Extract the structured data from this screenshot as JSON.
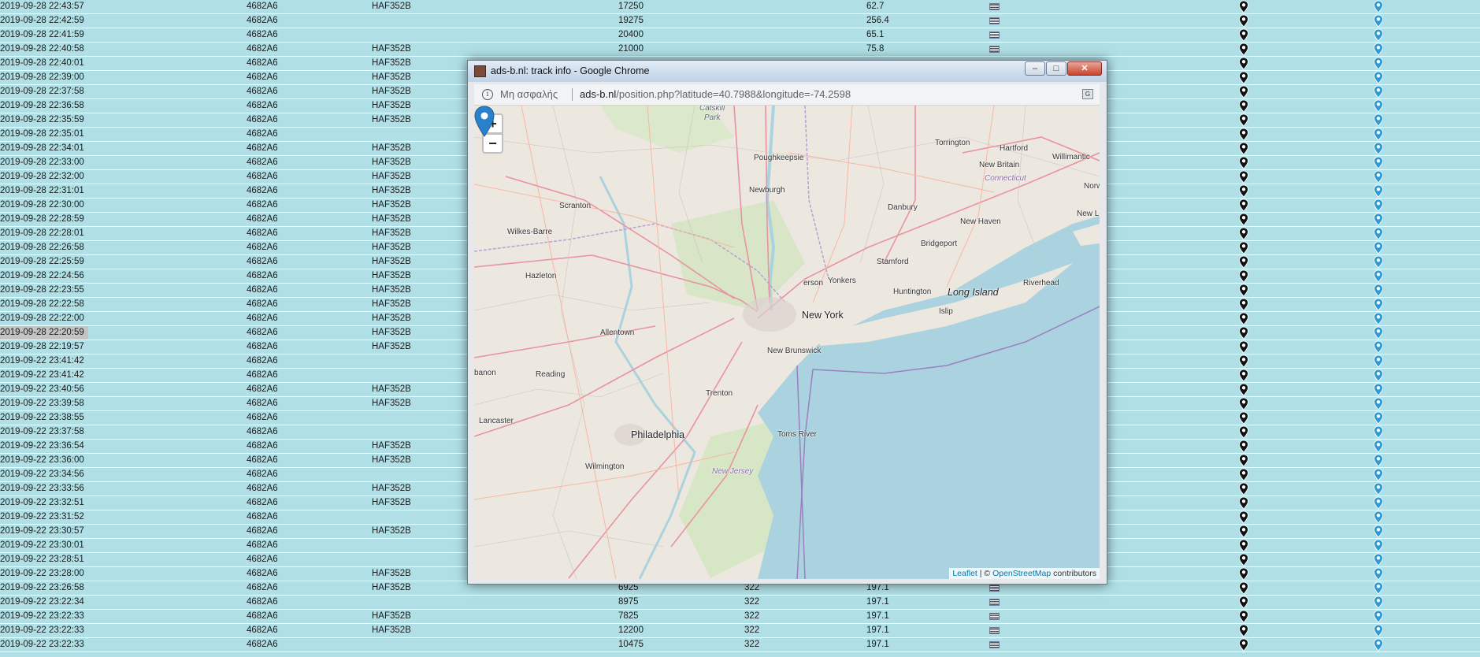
{
  "rows": [
    {
      "time": "2019-09-28 22:43:57",
      "icao": "4682A6",
      "reg": "HAF352B",
      "alt": "17250",
      "speed": "62.7"
    },
    {
      "time": "2019-09-28 22:42:59",
      "icao": "4682A6",
      "reg": "",
      "alt": "19275",
      "speed": "256.4"
    },
    {
      "time": "2019-09-28 22:41:59",
      "icao": "4682A6",
      "reg": "",
      "alt": "20400",
      "speed": "65.1"
    },
    {
      "time": "2019-09-28 22:40:58",
      "icao": "4682A6",
      "reg": "HAF352B",
      "alt": "21000",
      "speed": "75.8"
    },
    {
      "time": "2019-09-28 22:40:01",
      "icao": "4682A6",
      "reg": "HAF352B",
      "alt": "",
      "speed": ""
    },
    {
      "time": "2019-09-28 22:39:00",
      "icao": "4682A6",
      "reg": "HAF352B",
      "alt": "",
      "speed": ""
    },
    {
      "time": "2019-09-28 22:37:58",
      "icao": "4682A6",
      "reg": "HAF352B",
      "alt": "",
      "speed": ""
    },
    {
      "time": "2019-09-28 22:36:58",
      "icao": "4682A6",
      "reg": "HAF352B",
      "alt": "",
      "speed": ""
    },
    {
      "time": "2019-09-28 22:35:59",
      "icao": "4682A6",
      "reg": "HAF352B",
      "alt": "",
      "speed": ""
    },
    {
      "time": "2019-09-28 22:35:01",
      "icao": "4682A6",
      "reg": "",
      "alt": "",
      "speed": ""
    },
    {
      "time": "2019-09-28 22:34:01",
      "icao": "4682A6",
      "reg": "HAF352B",
      "alt": "",
      "speed": ""
    },
    {
      "time": "2019-09-28 22:33:00",
      "icao": "4682A6",
      "reg": "HAF352B",
      "alt": "",
      "speed": ""
    },
    {
      "time": "2019-09-28 22:32:00",
      "icao": "4682A6",
      "reg": "HAF352B",
      "alt": "",
      "speed": ""
    },
    {
      "time": "2019-09-28 22:31:01",
      "icao": "4682A6",
      "reg": "HAF352B",
      "alt": "",
      "speed": ""
    },
    {
      "time": "2019-09-28 22:30:00",
      "icao": "4682A6",
      "reg": "HAF352B",
      "alt": "",
      "speed": ""
    },
    {
      "time": "2019-09-28 22:28:59",
      "icao": "4682A6",
      "reg": "HAF352B",
      "alt": "",
      "speed": ""
    },
    {
      "time": "2019-09-28 22:28:01",
      "icao": "4682A6",
      "reg": "HAF352B",
      "alt": "",
      "speed": ""
    },
    {
      "time": "2019-09-28 22:26:58",
      "icao": "4682A6",
      "reg": "HAF352B",
      "alt": "",
      "speed": ""
    },
    {
      "time": "2019-09-28 22:25:59",
      "icao": "4682A6",
      "reg": "HAF352B",
      "alt": "",
      "speed": ""
    },
    {
      "time": "2019-09-28 22:24:56",
      "icao": "4682A6",
      "reg": "HAF352B",
      "alt": "",
      "speed": ""
    },
    {
      "time": "2019-09-28 22:23:55",
      "icao": "4682A6",
      "reg": "HAF352B",
      "alt": "",
      "speed": ""
    },
    {
      "time": "2019-09-28 22:22:58",
      "icao": "4682A6",
      "reg": "HAF352B",
      "alt": "",
      "speed": ""
    },
    {
      "time": "2019-09-28 22:22:00",
      "icao": "4682A6",
      "reg": "HAF352B",
      "alt": "",
      "speed": ""
    },
    {
      "time": "2019-09-28 22:20:59",
      "icao": "4682A6",
      "reg": "HAF352B",
      "alt": "",
      "speed": "",
      "highlight": true
    },
    {
      "time": "2019-09-28 22:19:57",
      "icao": "4682A6",
      "reg": "HAF352B",
      "alt": "",
      "speed": ""
    },
    {
      "time": "2019-09-22 23:41:42",
      "icao": "4682A6",
      "reg": "",
      "alt": "",
      "speed": ""
    },
    {
      "time": "2019-09-22 23:41:42",
      "icao": "4682A6",
      "reg": "",
      "alt": "",
      "speed": ""
    },
    {
      "time": "2019-09-22 23:40:56",
      "icao": "4682A6",
      "reg": "HAF352B",
      "alt": "",
      "speed": ""
    },
    {
      "time": "2019-09-22 23:39:58",
      "icao": "4682A6",
      "reg": "HAF352B",
      "alt": "",
      "speed": ""
    },
    {
      "time": "2019-09-22 23:38:55",
      "icao": "4682A6",
      "reg": "",
      "alt": "",
      "speed": ""
    },
    {
      "time": "2019-09-22 23:37:58",
      "icao": "4682A6",
      "reg": "",
      "alt": "",
      "speed": ""
    },
    {
      "time": "2019-09-22 23:36:54",
      "icao": "4682A6",
      "reg": "HAF352B",
      "alt": "",
      "speed": ""
    },
    {
      "time": "2019-09-22 23:36:00",
      "icao": "4682A6",
      "reg": "HAF352B",
      "alt": "",
      "speed": ""
    },
    {
      "time": "2019-09-22 23:34:56",
      "icao": "4682A6",
      "reg": "",
      "alt": "",
      "speed": ""
    },
    {
      "time": "2019-09-22 23:33:56",
      "icao": "4682A6",
      "reg": "HAF352B",
      "alt": "",
      "speed": ""
    },
    {
      "time": "2019-09-22 23:32:51",
      "icao": "4682A6",
      "reg": "HAF352B",
      "alt": "",
      "speed": ""
    },
    {
      "time": "2019-09-22 23:31:52",
      "icao": "4682A6",
      "reg": "",
      "alt": "",
      "speed": ""
    },
    {
      "time": "2019-09-22 23:30:57",
      "icao": "4682A6",
      "reg": "HAF352B",
      "alt": "",
      "speed": ""
    },
    {
      "time": "2019-09-22 23:30:01",
      "icao": "4682A6",
      "reg": "",
      "alt": "",
      "speed": ""
    },
    {
      "time": "2019-09-22 23:28:51",
      "icao": "4682A6",
      "reg": "",
      "alt": "",
      "speed": ""
    },
    {
      "time": "2019-09-22 23:28:00",
      "icao": "4682A6",
      "reg": "HAF352B",
      "alt": "",
      "speed": ""
    },
    {
      "time": "2019-09-22 23:26:58",
      "icao": "4682A6",
      "reg": "HAF352B",
      "alt": "6925",
      "sqk": "322",
      "speed": "197.1"
    },
    {
      "time": "2019-09-22 23:22:34",
      "icao": "4682A6",
      "reg": "",
      "alt": "8975",
      "sqk": "322",
      "speed": "197.1"
    },
    {
      "time": "2019-09-22 23:22:33",
      "icao": "4682A6",
      "reg": "HAF352B",
      "alt": "7825",
      "sqk": "322",
      "speed": "197.1"
    },
    {
      "time": "2019-09-22 23:22:33",
      "icao": "4682A6",
      "reg": "HAF352B",
      "alt": "12200",
      "sqk": "322",
      "speed": "197.1"
    },
    {
      "time": "2019-09-22 23:22:33",
      "icao": "4682A6",
      "reg": "",
      "alt": "10475",
      "sqk": "322",
      "speed": "197.1"
    }
  ],
  "popup": {
    "window_title": "ads-b.nl: track info - Google Chrome",
    "security_label": "Μη ασφαλής",
    "url_host": "ads-b.nl",
    "url_path": "/position.php?latitude=40.7988&longitude=-74.2598",
    "zoom_in": "+",
    "zoom_out": "−",
    "attribution": {
      "leaflet": "Leaflet",
      "sep": " | © ",
      "osm": "OpenStreetMap",
      "contributors": " contributors"
    }
  },
  "map_labels": {
    "catskill": "Catskill",
    "park": "Park",
    "torrington": "Torrington",
    "hartford": "Hartford",
    "willimantic": "Willimantic",
    "poughkeepsie": "Poughkeepsie",
    "new_britain": "New Britain",
    "connecticut": "Connecticut",
    "norwich": "Norw",
    "newburgh": "Newburgh",
    "danbury": "Danbury",
    "scranton": "Scranton",
    "new_london": "New Lo",
    "wilkes_barre": "Wilkes-Barre",
    "new_haven": "New Haven",
    "bridgeport": "Bridgeport",
    "stamford": "Stamford",
    "hazleton": "Hazleton",
    "yonkers": "Yonkers",
    "paterson": "erson",
    "riverhead": "Riverhead",
    "huntington": "Huntington",
    "long_island": "Long Island",
    "new_york": "New York",
    "islip": "Islip",
    "allentown": "Allentown",
    "new_brunswick": "New Brunswick",
    "lebanon": "banon",
    "reading": "Reading",
    "trenton": "Trenton",
    "lancaster": "Lancaster",
    "philadelphia": "Philadelphia",
    "toms_river": "Toms River",
    "wilmington": "Wilmington",
    "new_jersey": "New Jersey"
  }
}
